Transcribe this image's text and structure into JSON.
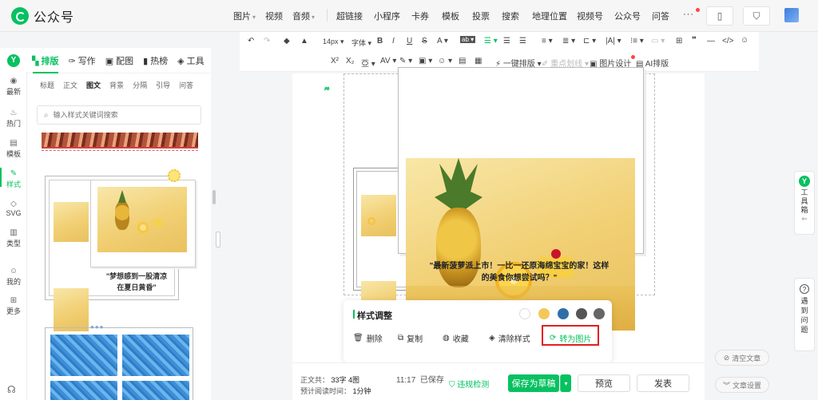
{
  "app": {
    "name": "公众号"
  },
  "topnav": {
    "group1": [
      {
        "label": "图片",
        "dropdown": true
      },
      {
        "label": "视频",
        "dropdown": false
      },
      {
        "label": "音频",
        "dropdown": true
      }
    ],
    "group2": [
      "超链接",
      "小程序",
      "卡券",
      "模板",
      "投票",
      "搜索",
      "地理位置",
      "视频号",
      "公众号",
      "问答"
    ],
    "more": "···"
  },
  "rail": [
    {
      "label": "最新",
      "icon": "◉"
    },
    {
      "label": "热门",
      "icon": "♨"
    },
    {
      "label": "模板",
      "icon": "▤"
    },
    {
      "label": "样式",
      "icon": "✎"
    },
    {
      "label": "SVG",
      "icon": "◇"
    },
    {
      "label": "类型",
      "icon": "▥"
    },
    {
      "label": "我的",
      "icon": "☺"
    },
    {
      "label": "更多",
      "icon": "⊞"
    }
  ],
  "panel": {
    "tabs": [
      {
        "label": "排版",
        "icon": "▚"
      },
      {
        "label": "写作",
        "icon": "✑"
      },
      {
        "label": "配图",
        "icon": "▣"
      },
      {
        "label": "热榜",
        "icon": "▮"
      },
      {
        "label": "工具",
        "icon": "◈"
      }
    ],
    "subtabs": [
      "标题",
      "正文",
      "图文",
      "背景",
      "分隔",
      "引导",
      "问答"
    ],
    "search_placeholder": "输入样式关键词搜索",
    "card1_caption": "\"梦想感到一股清凉\n在夏日黄昏\""
  },
  "toolbar": {
    "font_size": "14px",
    "font_family": "字体",
    "one_click": "一键排版",
    "highlight": "重点划线",
    "image_design": "图片设计",
    "ai_layout": "AI排版"
  },
  "article": {
    "caption": "\"最新菠萝派上市！一比一还原海绵宝宝的家！这样\n的美食你想尝试吗？\""
  },
  "style_panel": {
    "title": "样式调整",
    "colors": [
      "#ffffff",
      "#f4c75a",
      "#2f6fa8",
      "#555555",
      "#666666"
    ],
    "actions": [
      {
        "label": "删除",
        "icon": "🗑"
      },
      {
        "label": "复制",
        "icon": "⧉"
      },
      {
        "label": "收藏",
        "icon": "◍"
      },
      {
        "label": "清除样式",
        "icon": "◈"
      },
      {
        "label": "转为图片",
        "icon": "⟳"
      }
    ]
  },
  "bottom": {
    "word_count_label": "正文共：",
    "word_count_value": "33字 4图",
    "read_time_label": "预计阅读时间：",
    "read_time_value": "1分钟",
    "saved_time": "11:17",
    "saved_label": "已保存",
    "check_label": "违规检测",
    "save_draft": "保存为草稿",
    "preview": "预览",
    "publish": "发表"
  },
  "right": {
    "toolbox": "工具箱",
    "toolbox_arrow": "⇐",
    "help": "遇到问题",
    "clear": "清空文章",
    "settings": "文章设置"
  }
}
